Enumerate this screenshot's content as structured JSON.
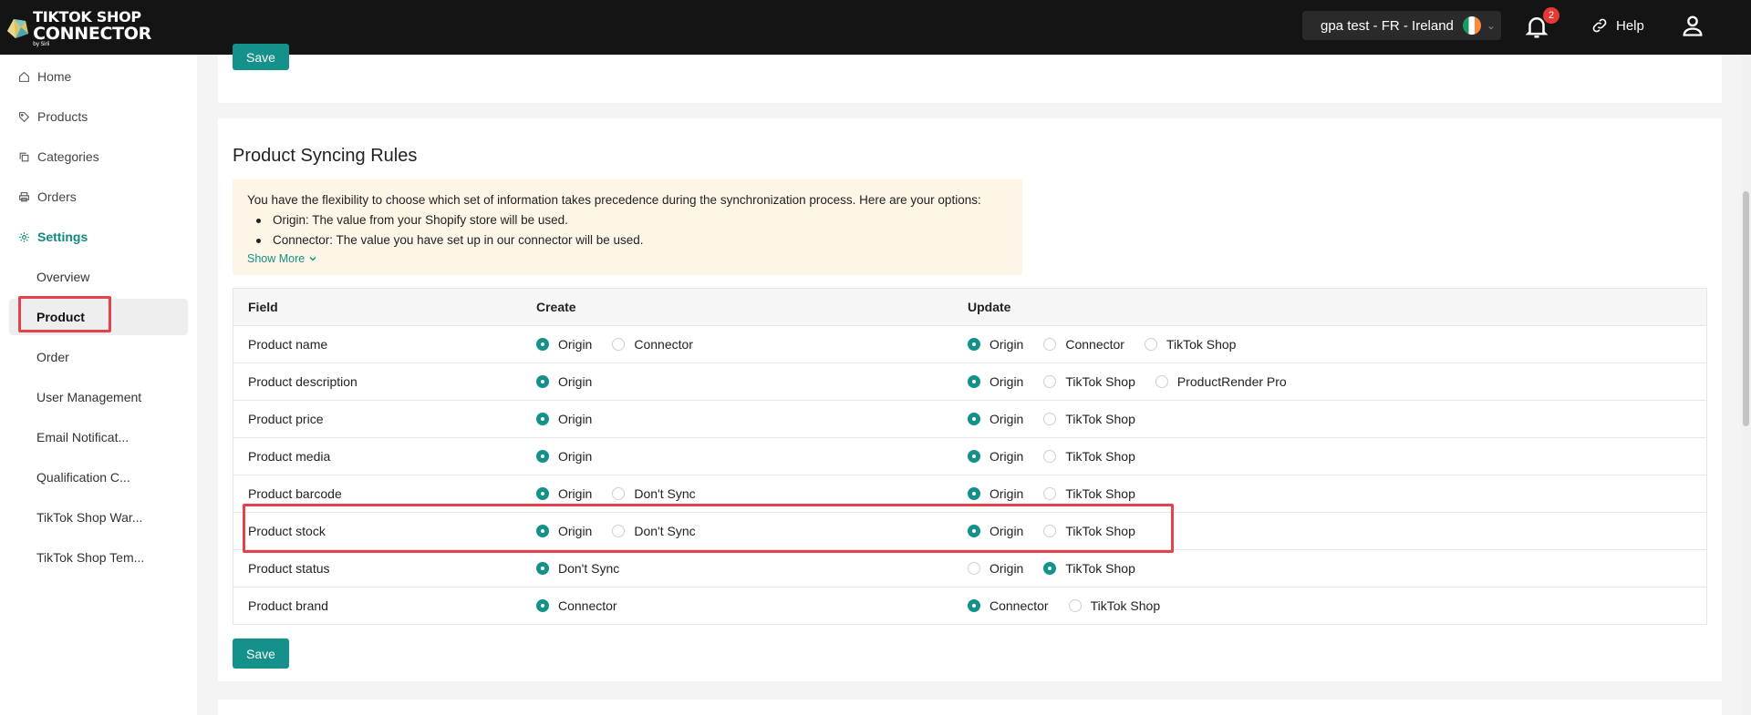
{
  "header": {
    "logo_line1": "TIKTOK SHOP",
    "logo_line2": "CONNECTOR",
    "logo_line3": "by Sirii",
    "store_label": "gpa test - FR  -  Ireland",
    "notification_count": "2",
    "help_label": "Help"
  },
  "sidebar": {
    "items": [
      {
        "label": "Home",
        "icon": "home-icon"
      },
      {
        "label": "Products",
        "icon": "tag-icon"
      },
      {
        "label": "Categories",
        "icon": "copy-icon"
      },
      {
        "label": "Orders",
        "icon": "printer-icon"
      },
      {
        "label": "Settings",
        "icon": "gear-icon"
      }
    ],
    "settings_sub": [
      "Overview",
      "Product",
      "Order",
      "User Management",
      "Email Notificat...",
      "Qualification C...",
      "TikTok Shop War...",
      "TikTok Shop Tem..."
    ]
  },
  "main": {
    "save_label": "Save",
    "title": "Product Syncing Rules",
    "info": {
      "intro": "You have the flexibility to choose which set of information takes precedence during the synchronization process. Here are your options:",
      "bullets": [
        "Origin: The value from your Shopify store will be used.",
        "Connector: The value you have set up in our connector will be used."
      ],
      "show_more": "Show More"
    },
    "table": {
      "headers": [
        "Field",
        "Create",
        "Update"
      ],
      "rows": [
        {
          "field": "Product name",
          "create": [
            [
              "Origin",
              true
            ],
            [
              "Connector",
              false
            ]
          ],
          "update": [
            [
              "Origin",
              true
            ],
            [
              "Connector",
              false
            ],
            [
              "TikTok Shop",
              false
            ]
          ]
        },
        {
          "field": "Product description",
          "create": [
            [
              "Origin",
              true
            ]
          ],
          "update": [
            [
              "Origin",
              true
            ],
            [
              "TikTok Shop",
              false
            ],
            [
              "ProductRender Pro",
              false
            ]
          ]
        },
        {
          "field": "Product price",
          "create": [
            [
              "Origin",
              true
            ]
          ],
          "update": [
            [
              "Origin",
              true
            ],
            [
              "TikTok Shop",
              false
            ]
          ]
        },
        {
          "field": "Product media",
          "create": [
            [
              "Origin",
              true
            ]
          ],
          "update": [
            [
              "Origin",
              true
            ],
            [
              "TikTok Shop",
              false
            ]
          ]
        },
        {
          "field": "Product barcode",
          "create": [
            [
              "Origin",
              true
            ],
            [
              "Don't Sync",
              false
            ]
          ],
          "update": [
            [
              "Origin",
              true
            ],
            [
              "TikTok Shop",
              false
            ]
          ]
        },
        {
          "field": "Product stock",
          "create": [
            [
              "Origin",
              true
            ],
            [
              "Don't Sync",
              false
            ]
          ],
          "update": [
            [
              "Origin",
              true
            ],
            [
              "TikTok Shop",
              false
            ]
          ]
        },
        {
          "field": "Product status",
          "create": [
            [
              "Don't Sync",
              true
            ]
          ],
          "update": [
            [
              "Origin",
              false
            ],
            [
              "TikTok Shop",
              true
            ]
          ]
        },
        {
          "field": "Product brand",
          "create": [
            [
              "Connector",
              true
            ]
          ],
          "update": [
            [
              "Connector",
              true
            ],
            [
              "TikTok Shop",
              false
            ]
          ]
        }
      ]
    }
  },
  "colors": {
    "accent": "#14918a",
    "highlight": "#e8414e"
  }
}
